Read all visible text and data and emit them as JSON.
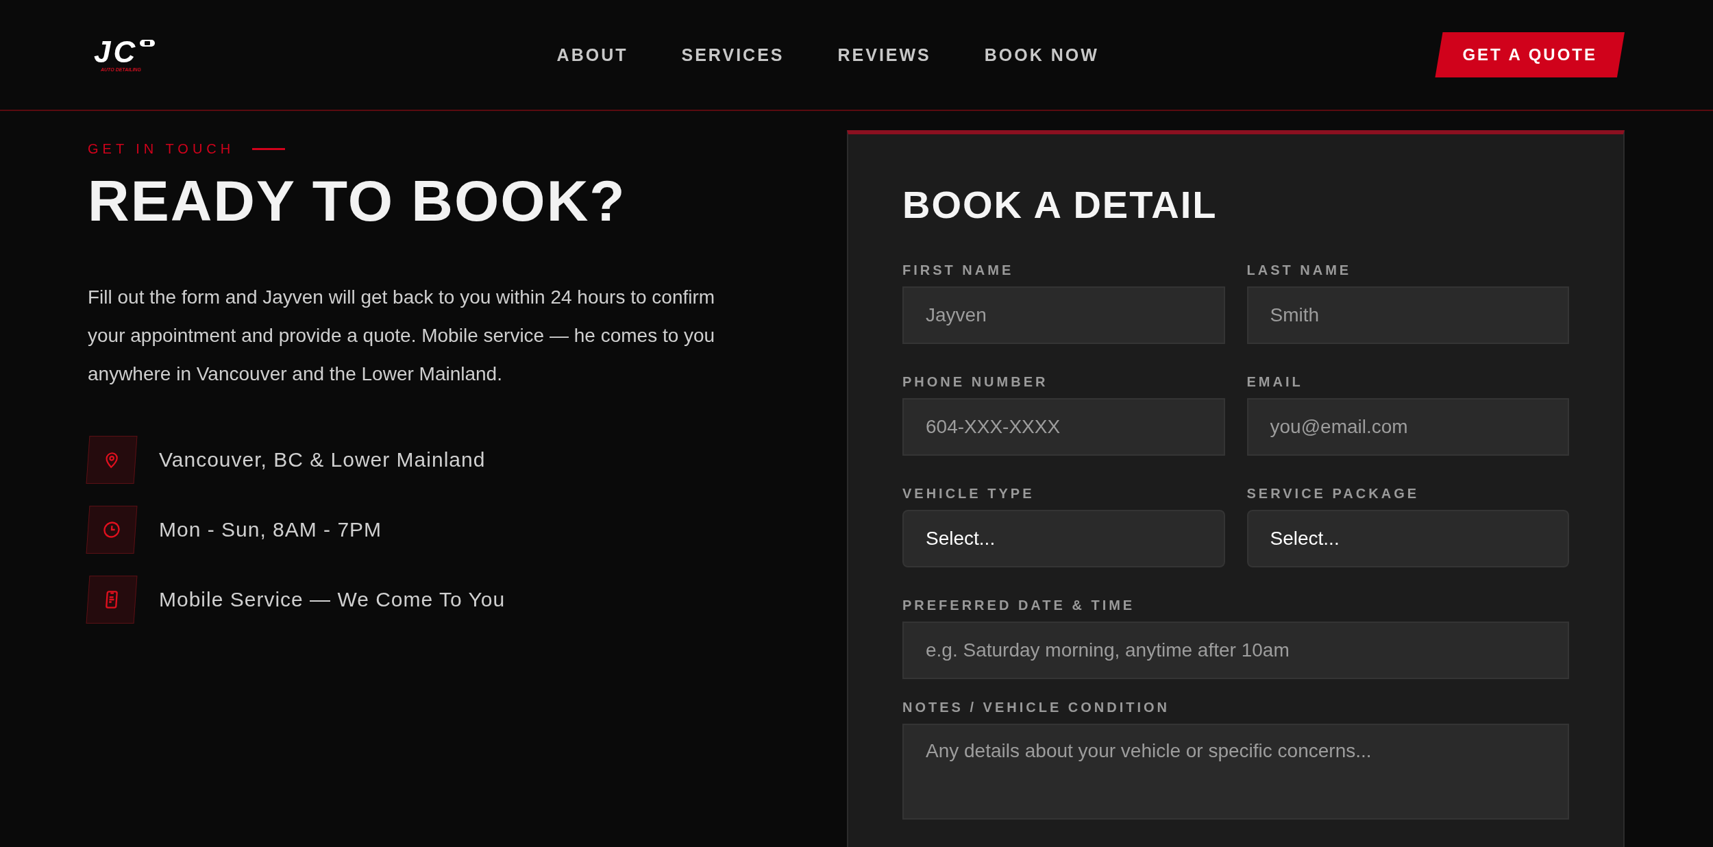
{
  "header": {
    "logo": {
      "mark": "JC",
      "tagline": "AUTO DETAILING"
    },
    "nav": [
      {
        "label": "ABOUT"
      },
      {
        "label": "SERVICES"
      },
      {
        "label": "REVIEWS"
      },
      {
        "label": "BOOK NOW"
      }
    ],
    "cta": "GET A QUOTE"
  },
  "intro": {
    "eyebrow": "GET IN TOUCH",
    "title": "READY TO BOOK?",
    "text": "Fill out the form and Jayven will get back to you within 24 hours to confirm your appointment and provide a quote. Mobile service — he comes to you anywhere in Vancouver and the Lower Mainland.",
    "contacts": [
      {
        "kind": "location",
        "text": "Vancouver, BC & Lower Mainland"
      },
      {
        "kind": "clock",
        "text": "Mon - Sun, 8AM - 7PM"
      },
      {
        "kind": "phone",
        "text": "Mobile Service — We Come To You"
      }
    ]
  },
  "form": {
    "title": "BOOK A DETAIL",
    "rows": [
      [
        {
          "label": "FIRST NAME",
          "kind": "input",
          "placeholder": "Jayven"
        },
        {
          "label": "LAST NAME",
          "kind": "input",
          "placeholder": "Smith"
        }
      ],
      [
        {
          "label": "PHONE NUMBER",
          "kind": "input",
          "placeholder": "604-XXX-XXXX"
        },
        {
          "label": "EMAIL",
          "kind": "input",
          "placeholder": "you@email.com"
        }
      ],
      [
        {
          "label": "VEHICLE TYPE",
          "kind": "select",
          "value": "Select..."
        },
        {
          "label": "SERVICE PACKAGE",
          "kind": "select",
          "value": "Select..."
        }
      ],
      [
        {
          "label": "PREFERRED DATE & TIME",
          "kind": "input",
          "placeholder": "e.g. Saturday morning, anytime after 10am"
        }
      ],
      [
        {
          "label": "NOTES / VEHICLE CONDITION",
          "kind": "textarea",
          "placeholder": "Any details about your vehicle or specific concerns..."
        }
      ]
    ]
  }
}
